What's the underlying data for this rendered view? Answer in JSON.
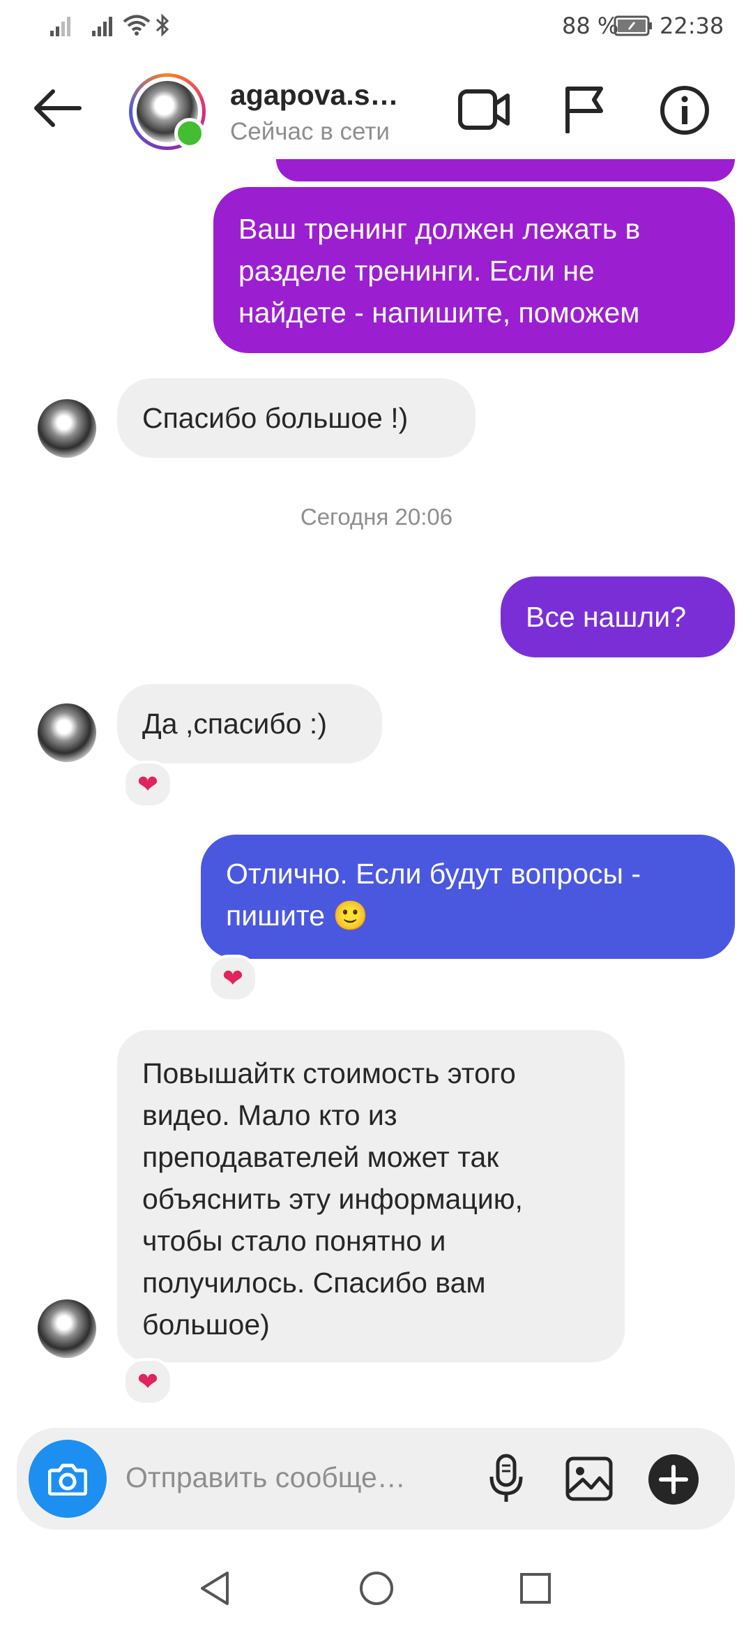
{
  "status_bar": {
    "battery": "88 %",
    "time": "22:38"
  },
  "header": {
    "username": "agapova.s…",
    "presence": "Сейчас в сети"
  },
  "messages": [
    {
      "side": "out",
      "text": "Ваш тренинг должен лежать в разделе тренинги. Если не найдете - напишите, поможем"
    },
    {
      "side": "in",
      "text": "Спасибо большое !)"
    },
    {
      "side": "in",
      "text": "Да ,спасибо :)",
      "reaction": "❤"
    },
    {
      "side": "out",
      "text_line1": "Отлично. Если будут вопросы -",
      "text_line2": "пишите 🙂",
      "reaction": "❤"
    },
    {
      "side": "in",
      "text": "Повышайтк стоимость этого видео. Мало кто из преподавателей может так объяснить эту информацию, чтобы стало понятно и получилось. Спасибо вам большое)",
      "reaction": "❤"
    }
  ],
  "out_short": "Все нашли?",
  "timestamp": "Сегодня 20:06",
  "composer": {
    "placeholder": "Отправить сообще…"
  },
  "colors": {
    "out_bubble_1": "#9b1fd0",
    "out_bubble_2": "#7a2fd6",
    "out_bubble_3": "#4a58e0",
    "camera": "#1d8ff0",
    "online": "#44bd32",
    "heart": "#e0245e"
  },
  "icons": [
    "signal-icon",
    "wifi-icon",
    "bluetooth-icon",
    "battery-icon",
    "back-arrow-icon",
    "video-call-icon",
    "flag-icon",
    "info-icon",
    "camera-icon",
    "microphone-icon",
    "gallery-icon",
    "plus-icon",
    "nav-back-icon",
    "nav-home-icon",
    "nav-recents-icon"
  ]
}
